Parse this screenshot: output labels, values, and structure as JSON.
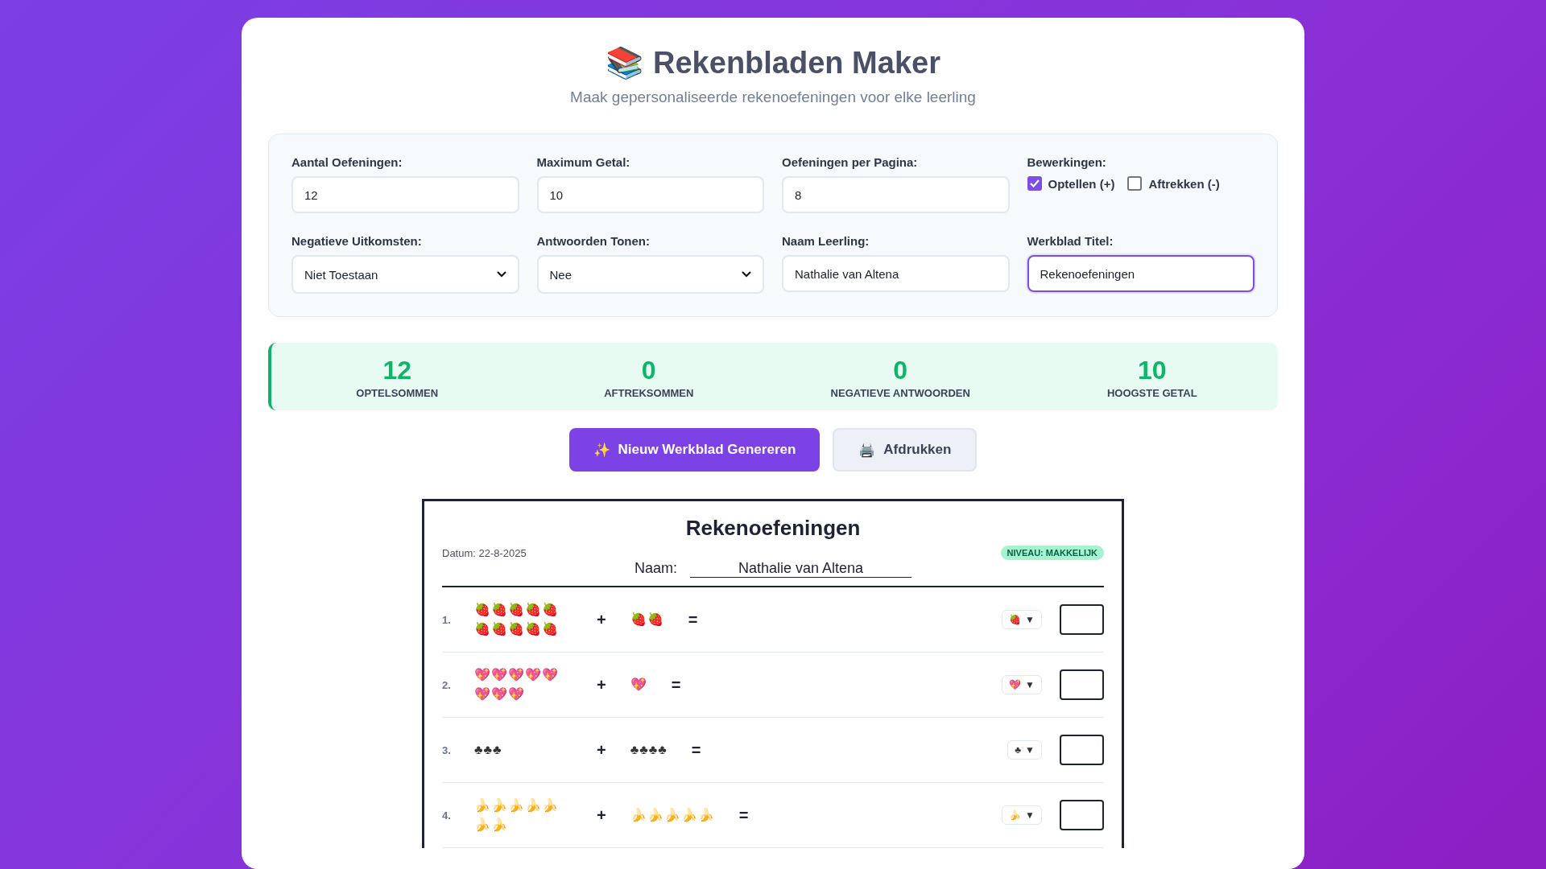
{
  "header": {
    "icon": "📚",
    "title": "Rekenbladen Maker",
    "subtitle": "Maak gepersonaliseerde rekenoefeningen voor elke leerling"
  },
  "settings": [
    {
      "kind": "text",
      "label": "Aantal Oefeningen:",
      "value": "12",
      "focused": false
    },
    {
      "kind": "text",
      "label": "Maximum Getal:",
      "value": "10",
      "focused": false
    },
    {
      "kind": "text",
      "label": "Oefeningen per Pagina:",
      "value": "8",
      "focused": false
    },
    {
      "kind": "checks",
      "label": "Bewerkingen:",
      "options": [
        {
          "label": "Optellen (+)",
          "checked": true
        },
        {
          "label": "Aftrekken (-)",
          "checked": false
        }
      ]
    },
    {
      "kind": "select",
      "label": "Negatieve Uitkomsten:",
      "value": "Niet Toestaan",
      "focused": false
    },
    {
      "kind": "select",
      "label": "Antwoorden Tonen:",
      "value": "Nee",
      "focused": false
    },
    {
      "kind": "text",
      "label": "Naam Leerling:",
      "value": "Nathalie van Altena",
      "focused": false
    },
    {
      "kind": "text",
      "label": "Werkblad Titel:",
      "value": "Rekenoefeningen",
      "focused": true
    }
  ],
  "stats": [
    {
      "value": "12",
      "label": "OPTELSOMMEN"
    },
    {
      "value": "0",
      "label": "AFTREKSOMMEN"
    },
    {
      "value": "0",
      "label": "NEGATIEVE ANTWOORDEN"
    },
    {
      "value": "10",
      "label": "HOOGSTE GETAL"
    }
  ],
  "buttons": [
    {
      "kind": "primary",
      "icon": "✨",
      "label": "Nieuw Werkblad Genereren"
    },
    {
      "kind": "secondary",
      "icon": "🖨️",
      "label": "Afdrukken"
    }
  ],
  "worksheet": {
    "title": "Rekenoefeningen",
    "date": "Datum: 22-8-2025",
    "level_badge": "NIVEAU: MAKKELIJK",
    "name_label": "Naam:",
    "name_value": "Nathalie van Altena",
    "problems": [
      {
        "number": "1.",
        "left": "🍓🍓🍓🍓🍓🍓🍓🍓🍓🍓",
        "operator": "+",
        "right": "🍓🍓",
        "equals": "=",
        "picker_symbol": "🍓",
        "picker_caret": "▼"
      },
      {
        "number": "2.",
        "left": "💖💖💖💖💖💖💖💖",
        "operator": "+",
        "right": "💖",
        "equals": "=",
        "picker_symbol": "💖",
        "picker_caret": "▼"
      },
      {
        "number": "3.",
        "left": "♣♣♣",
        "operator": "+",
        "right": "♣♣♣♣",
        "equals": "=",
        "picker_symbol": "♣",
        "picker_caret": "▼"
      },
      {
        "number": "4.",
        "left": "🍌🍌🍌🍌🍌🍌🍌",
        "operator": "+",
        "right": "🍌🍌🍌🍌🍌",
        "equals": "=",
        "picker_symbol": "🍌",
        "picker_caret": "▼"
      }
    ]
  }
}
